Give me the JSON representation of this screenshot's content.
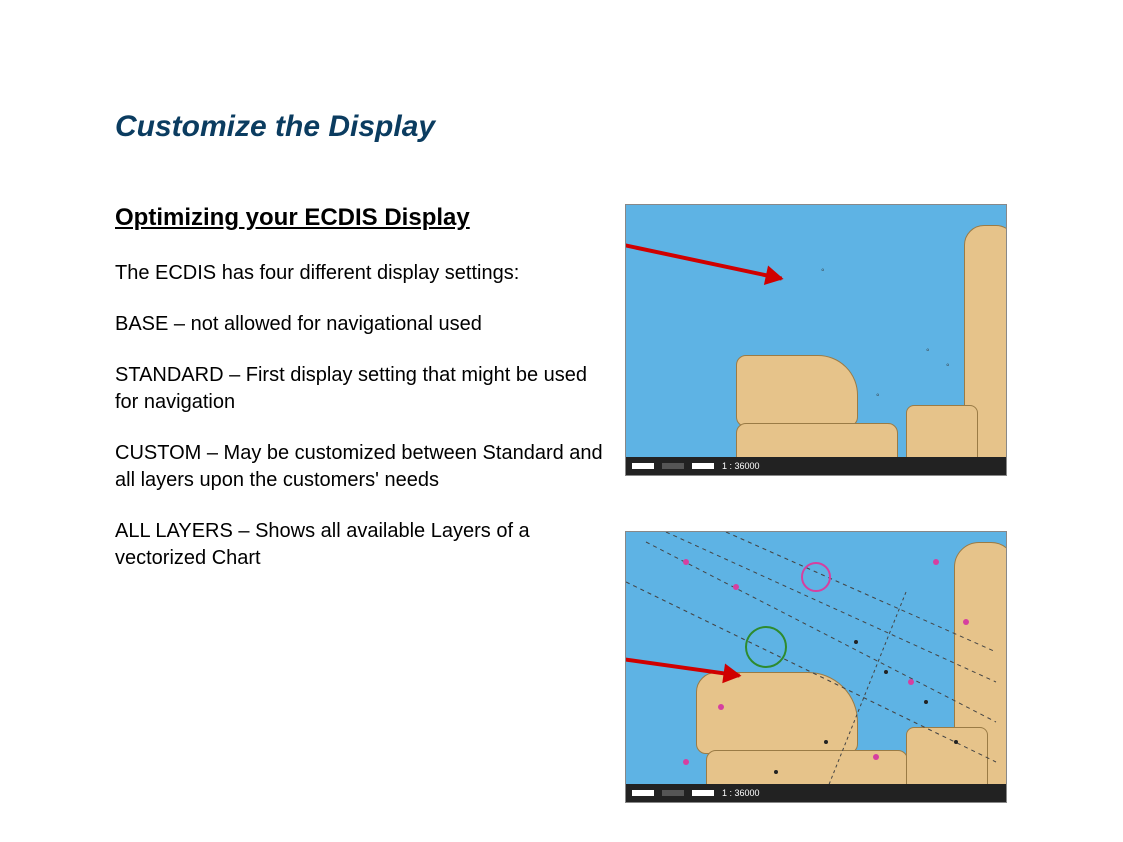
{
  "title": "Customize the Display",
  "subheading": "Optimizing your ECDIS Display",
  "intro": "The ECDIS has four different display settings:",
  "base": "BASE – not allowed for navigational used",
  "standard": "STANDARD – First display setting that might be used for navigation",
  "custom": "CUSTOM – May be customized between Standard and all layers upon the customers' needs",
  "all": "ALL LAYERS – Shows all available Layers of a vectorized Chart",
  "scale": "1 : 36000"
}
